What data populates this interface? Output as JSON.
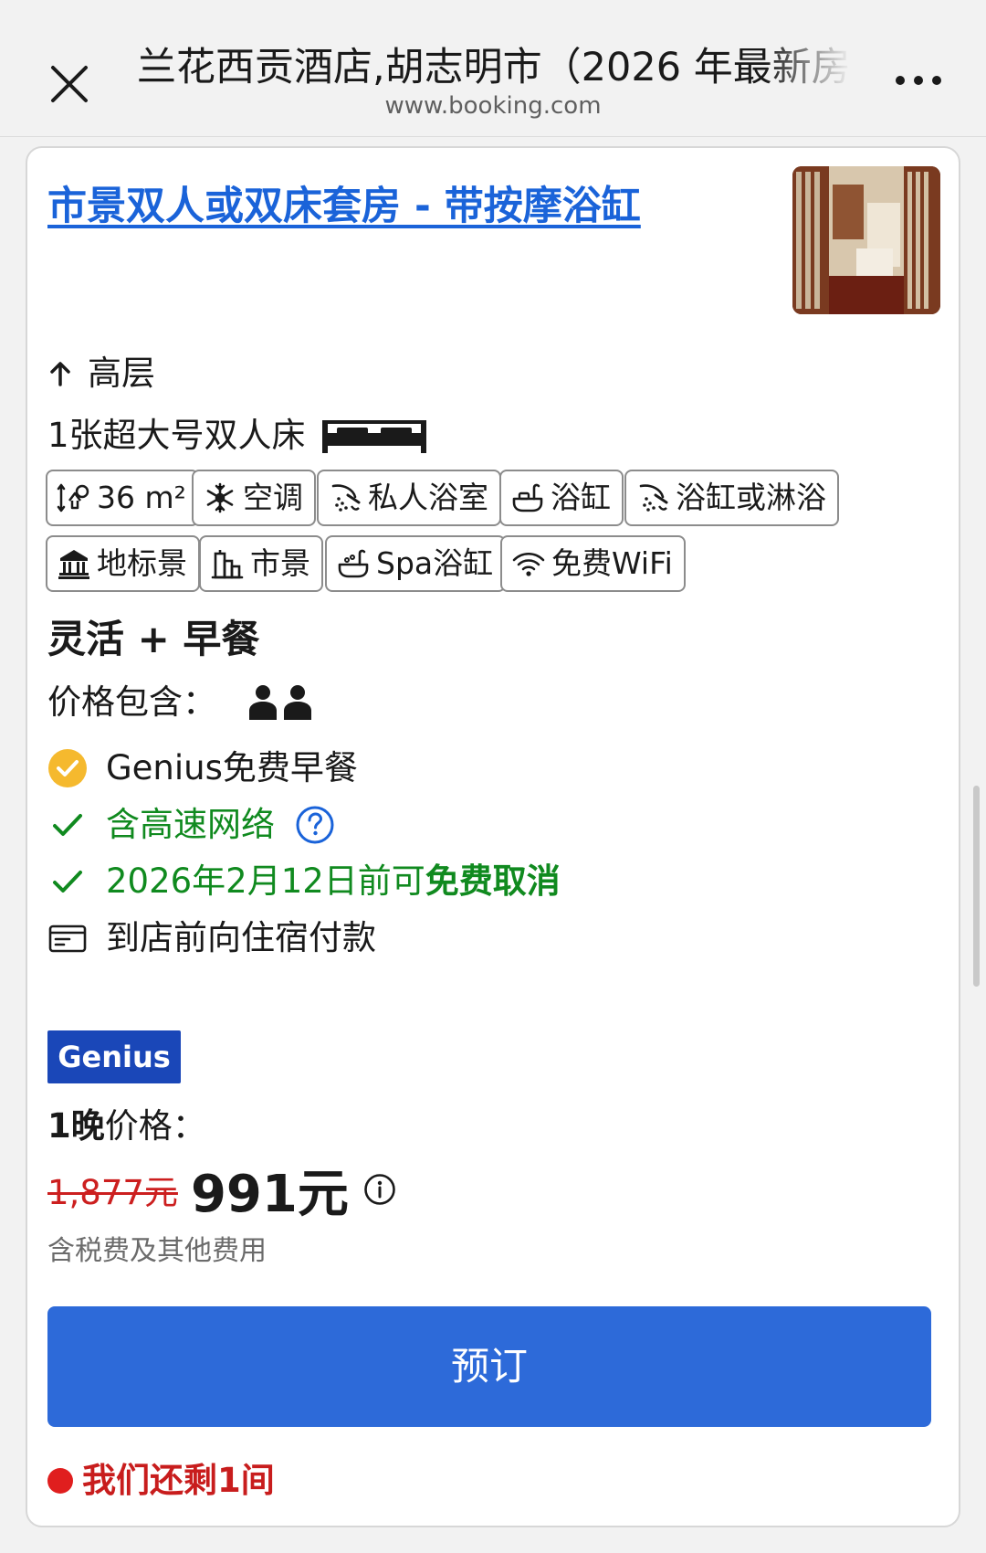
{
  "header": {
    "title": "兰花西贡酒店,胡志明市（2026 年最新房",
    "url": "www.booking.com"
  },
  "room": {
    "name": "市景双人或双床套房 - 带按摩浴缸",
    "floor": "高层",
    "bed": "1张超大号双人床",
    "amenities": [
      {
        "label": "36 m²",
        "icon": "room-size-icon"
      },
      {
        "label": "空调",
        "icon": "snowflake-icon"
      },
      {
        "label": "私人浴室",
        "icon": "shower-icon"
      },
      {
        "label": "浴缸",
        "icon": "bathtub-icon"
      },
      {
        "label": "浴缸或淋浴",
        "icon": "shower-icon"
      },
      {
        "label": "地标景",
        "icon": "landmark-icon"
      },
      {
        "label": "市景",
        "icon": "city-icon"
      },
      {
        "label": "Spa浴缸",
        "icon": "spa-bath-icon"
      },
      {
        "label": "免费WiFi",
        "icon": "wifi-icon"
      }
    ]
  },
  "plan": {
    "title": "灵活 + 早餐",
    "price_includes": "价格包含：",
    "genius_breakfast": "Genius免费早餐",
    "internet": "含高速网络",
    "cancel_prefix": "2026年2月12日前可",
    "cancel_bold": "免费取消",
    "payment": "到店前向住宿付款"
  },
  "pricing": {
    "badge": "Genius",
    "nights_bold": "1晚",
    "nights_suffix": "价格：",
    "old_price": "1,877元",
    "new_price": "991元",
    "tax_note": "含税费及其他费用"
  },
  "actions": {
    "book": "预订"
  },
  "availability": {
    "text": "我们还剩1间"
  },
  "colors": {
    "link_blue": "#1a63d9",
    "button_blue": "#2d6ad9",
    "genius_blue": "#1a47b8",
    "green": "#108a1f",
    "red": "#cc1f1f",
    "genius_yellow": "#f5b92e"
  }
}
